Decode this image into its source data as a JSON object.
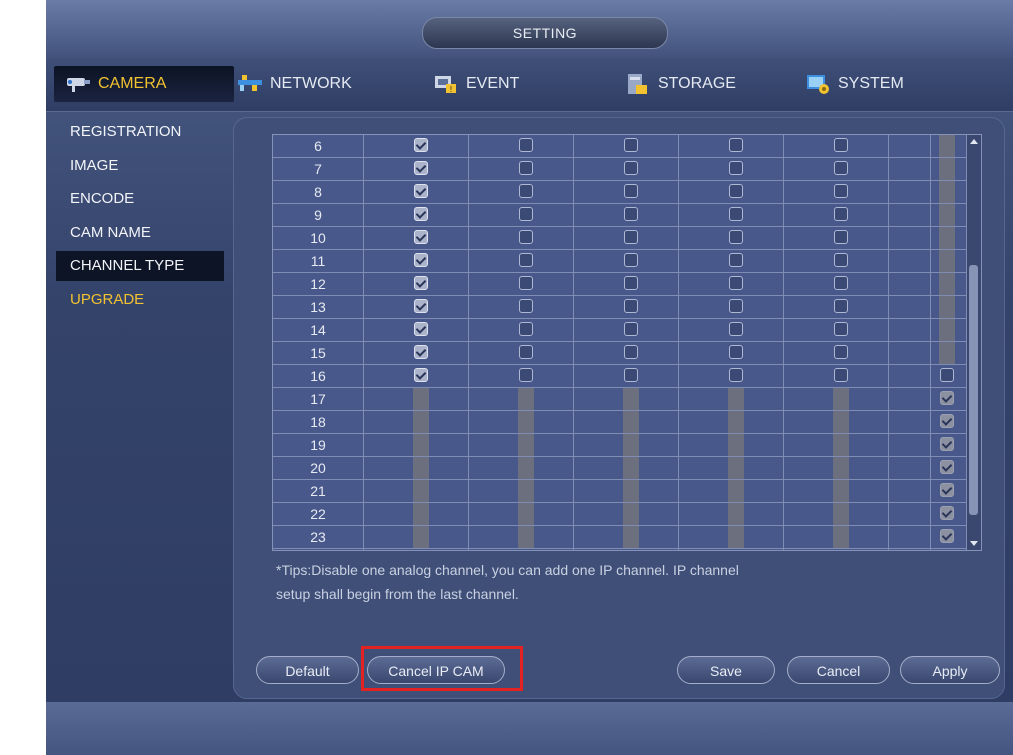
{
  "window": {
    "title": "SETTING"
  },
  "tabs": [
    {
      "label": "CAMERA",
      "active": true
    },
    {
      "label": "NETWORK",
      "active": false
    },
    {
      "label": "EVENT",
      "active": false
    },
    {
      "label": "STORAGE",
      "active": false
    },
    {
      "label": "SYSTEM",
      "active": false
    }
  ],
  "menu": [
    {
      "label": "REGISTRATION"
    },
    {
      "label": "IMAGE"
    },
    {
      "label": "ENCODE"
    },
    {
      "label": "CAM NAME"
    },
    {
      "label": "CHANNEL TYPE",
      "selected": true
    },
    {
      "label": "UPGRADE",
      "warning": true
    }
  ],
  "table": {
    "rows": [
      {
        "channel": "6"
      },
      {
        "channel": "7"
      },
      {
        "channel": "8"
      },
      {
        "channel": "9"
      },
      {
        "channel": "10"
      },
      {
        "channel": "11"
      },
      {
        "channel": "12"
      },
      {
        "channel": "13"
      },
      {
        "channel": "14"
      },
      {
        "channel": "15"
      },
      {
        "channel": "16"
      },
      {
        "channel": "17"
      },
      {
        "channel": "18"
      },
      {
        "channel": "19"
      },
      {
        "channel": "20"
      },
      {
        "channel": "21"
      },
      {
        "channel": "22"
      },
      {
        "channel": "23"
      }
    ]
  },
  "tips": {
    "line1": "*Tips:Disable one analog channel, you can add one IP channel. IP channel",
    "line2": "setup shall begin from the last channel."
  },
  "buttons": {
    "default": "Default",
    "cancel_ip_cam": "Cancel IP CAM",
    "save": "Save",
    "cancel": "Cancel",
    "apply": "Apply"
  },
  "colors": {
    "accent": "#f2c230",
    "highlight": "#e32222"
  }
}
